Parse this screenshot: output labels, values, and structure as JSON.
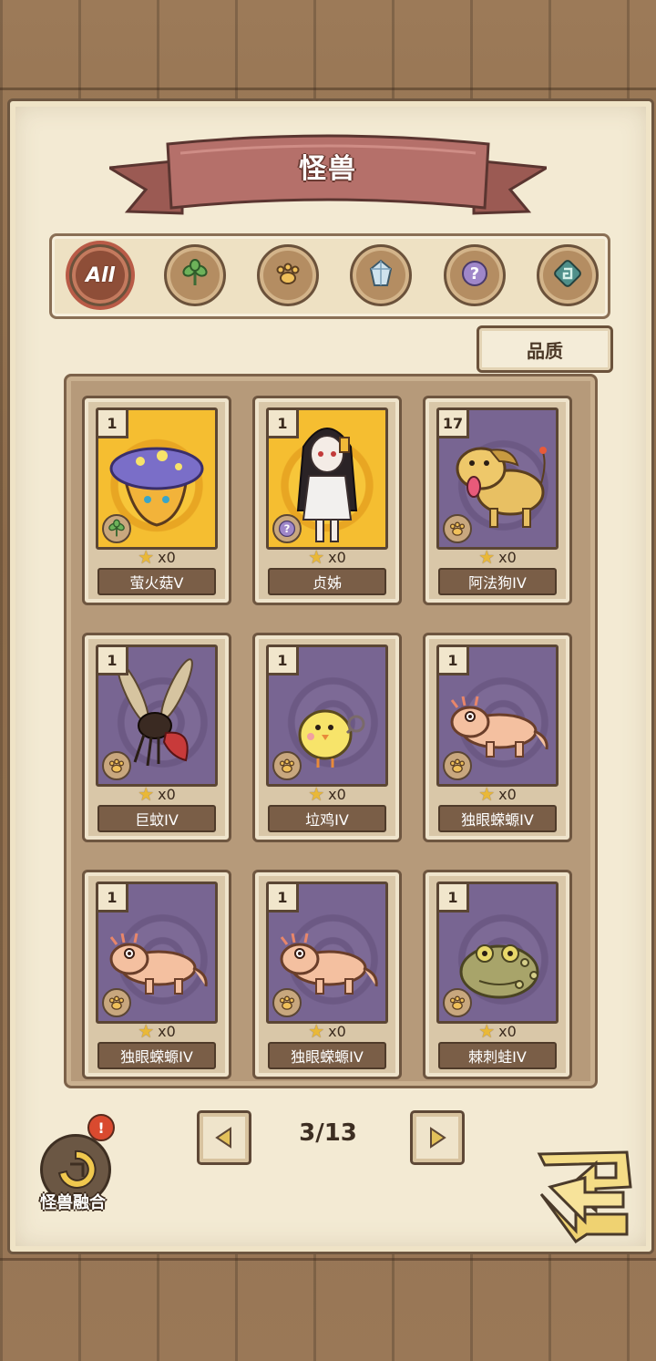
{
  "header": {
    "title": "怪兽"
  },
  "filters": [
    {
      "name": "filter-all",
      "label": "All",
      "icon": "all-text",
      "active": true
    },
    {
      "name": "filter-plant",
      "label": "",
      "icon": "leaf-icon",
      "active": false
    },
    {
      "name": "filter-beast",
      "label": "",
      "icon": "paw-icon",
      "active": false
    },
    {
      "name": "filter-crystal",
      "label": "",
      "icon": "crystal-icon",
      "active": false
    },
    {
      "name": "filter-mystery",
      "label": "",
      "icon": "question-icon",
      "active": false
    },
    {
      "name": "filter-special",
      "label": "",
      "icon": "rune-icon",
      "active": false
    }
  ],
  "sort": {
    "label": "品质"
  },
  "cards": [
    {
      "count": "1",
      "stars": "x0",
      "name": "萤火菇V",
      "art": "gold",
      "type_icon": "leaf-icon",
      "monster": "mushroom"
    },
    {
      "count": "1",
      "stars": "x0",
      "name": "贞姊",
      "art": "gold",
      "type_icon": "question-icon",
      "monster": "ghost-girl"
    },
    {
      "count": "17",
      "stars": "x0",
      "name": "阿法狗IV",
      "art": "purple",
      "type_icon": "paw-icon",
      "monster": "dog"
    },
    {
      "count": "1",
      "stars": "x0",
      "name": "巨蚊IV",
      "art": "purple",
      "type_icon": "paw-icon",
      "monster": "mosquito"
    },
    {
      "count": "1",
      "stars": "x0",
      "name": "垃鸡IV",
      "art": "purple",
      "type_icon": "paw-icon",
      "monster": "chick"
    },
    {
      "count": "1",
      "stars": "x0",
      "name": "独眼蝾螈IV",
      "art": "purple",
      "type_icon": "paw-icon",
      "monster": "salamander"
    },
    {
      "count": "1",
      "stars": "x0",
      "name": "独眼蝾螈IV",
      "art": "purple",
      "type_icon": "paw-icon",
      "monster": "salamander"
    },
    {
      "count": "1",
      "stars": "x0",
      "name": "独眼蝾螈IV",
      "art": "purple",
      "type_icon": "paw-icon",
      "monster": "salamander"
    },
    {
      "count": "1",
      "stars": "x0",
      "name": "棘刺蛙IV",
      "art": "purple",
      "type_icon": "paw-icon",
      "monster": "toad"
    }
  ],
  "pager": {
    "page": "3/13"
  },
  "fusion": {
    "label": "怪兽融合",
    "alert": "!"
  },
  "colors": {
    "paper": "#f3ead3",
    "ribbon": "#b5706a",
    "frame": "#b69a7a",
    "accent": "#e9b838"
  }
}
